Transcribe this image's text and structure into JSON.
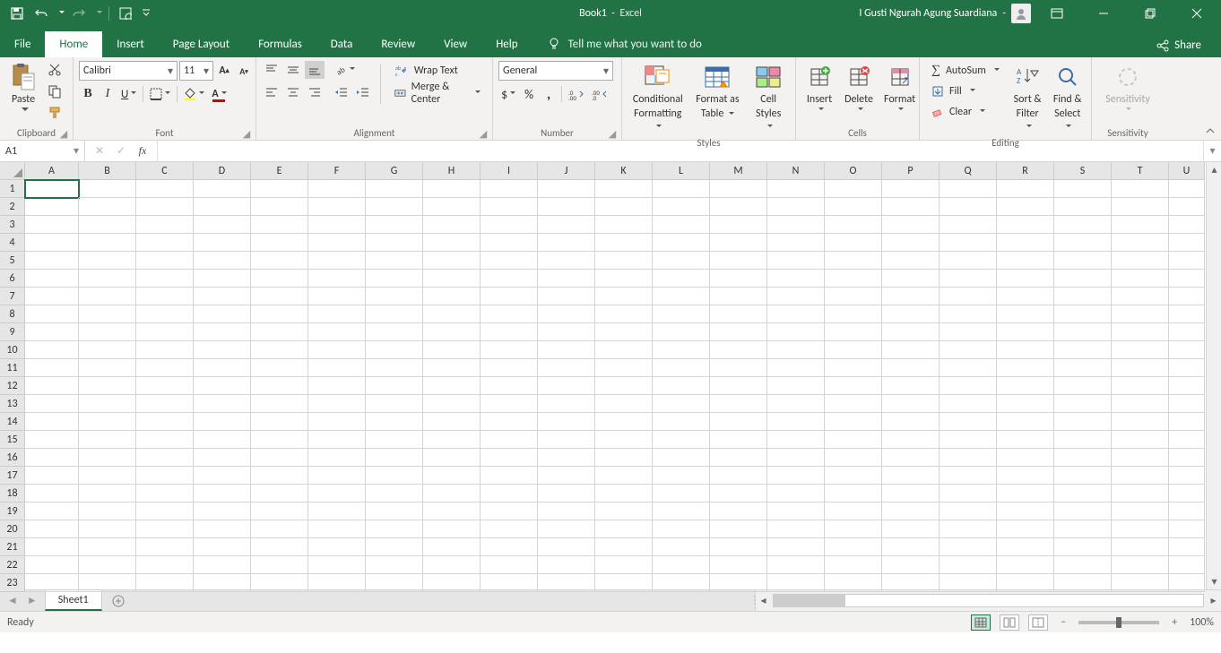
{
  "titlebar": {
    "doc_title": "Book1",
    "app_name": "Excel",
    "user_name": "I Gusti Ngurah Agung Suardiana"
  },
  "tabs": {
    "items": [
      "File",
      "Home",
      "Insert",
      "Page Layout",
      "Formulas",
      "Data",
      "Review",
      "View",
      "Help"
    ],
    "active": "Home",
    "tellme": "Tell me what you want to do",
    "share": "Share"
  },
  "ribbon": {
    "clipboard": {
      "label": "Clipboard",
      "paste": "Paste"
    },
    "font": {
      "label": "Font",
      "name": "Calibri",
      "size": "11"
    },
    "alignment": {
      "label": "Alignment",
      "wrap": "Wrap Text",
      "merge": "Merge & Center"
    },
    "number": {
      "label": "Number",
      "format": "General"
    },
    "styles": {
      "label": "Styles",
      "cond": "Conditional",
      "cond2": "Formatting",
      "fmt_table": "Format as",
      "fmt_table2": "Table",
      "cell": "Cell",
      "cell2": "Styles"
    },
    "cells": {
      "label": "Cells",
      "insert": "Insert",
      "delete": "Delete",
      "format": "Format"
    },
    "editing": {
      "label": "Editing",
      "autosum": "AutoSum",
      "fill": "Fill",
      "clear": "Clear",
      "sort": "Sort &",
      "sort2": "Filter",
      "find": "Find &",
      "find2": "Select"
    },
    "sensitivity": {
      "label": "Sensitivity",
      "btn": "Sensitivity"
    }
  },
  "fbar": {
    "namebox": "A1"
  },
  "columns": [
    "A",
    "B",
    "C",
    "D",
    "E",
    "F",
    "G",
    "H",
    "I",
    "J",
    "K",
    "L",
    "M",
    "N",
    "O",
    "P",
    "Q",
    "R",
    "S",
    "T",
    "U"
  ],
  "rows_count": 23,
  "active_cell": {
    "row": 1,
    "col": 0
  },
  "sheets": {
    "active": "Sheet1"
  },
  "statusbar": {
    "ready": "Ready",
    "zoom": "100%"
  }
}
